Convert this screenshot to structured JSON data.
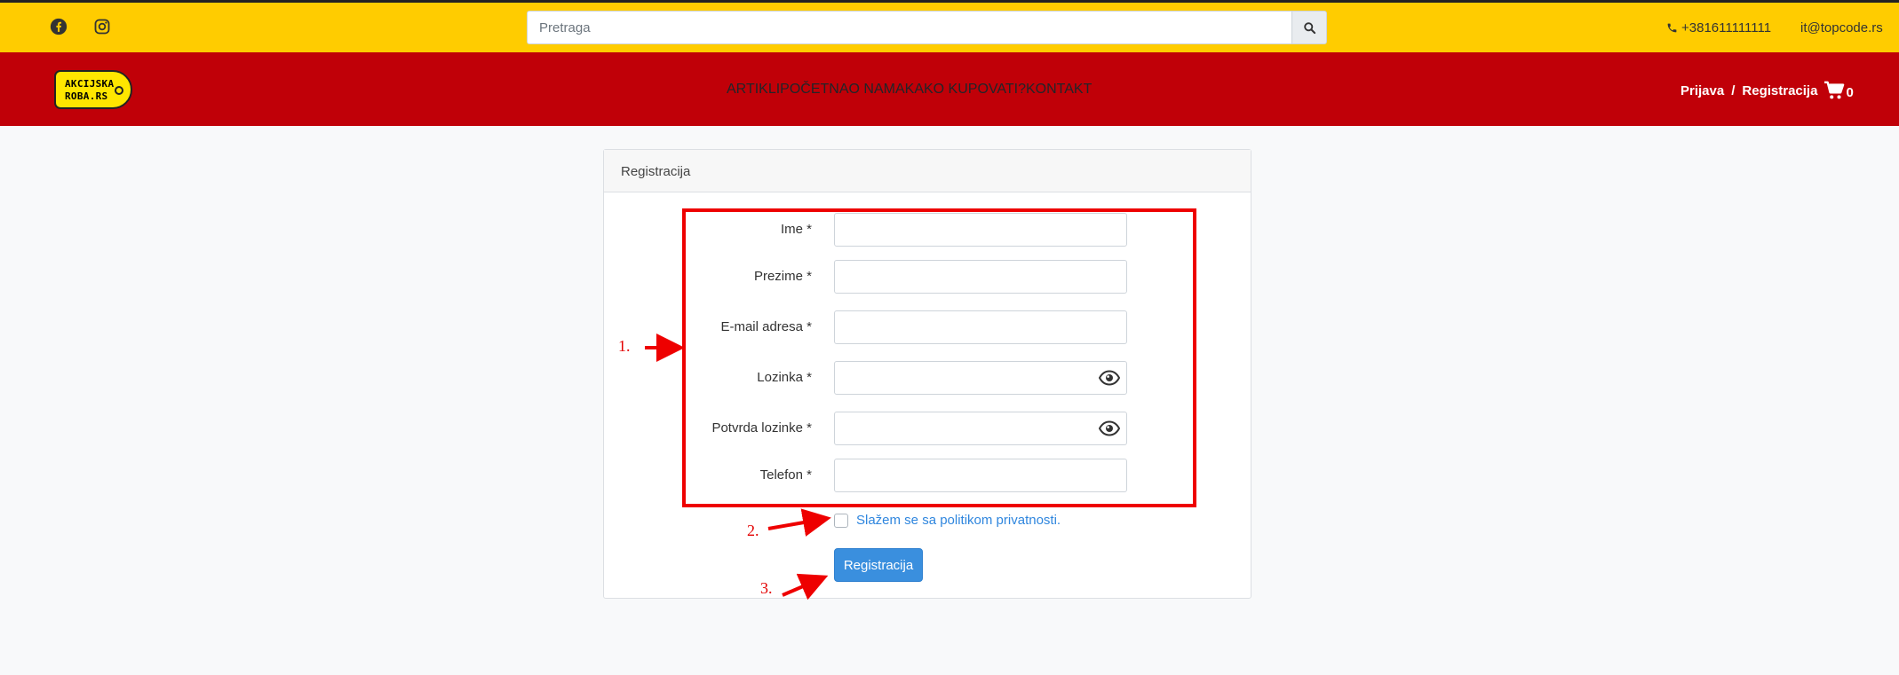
{
  "topbar": {
    "search_placeholder": "Pretraga",
    "phone": "+381611111111",
    "email": "it@topcode.rs",
    "icons": [
      "facebook-icon",
      "instagram-icon",
      "search-icon",
      "phone-icon"
    ]
  },
  "navbar": {
    "logo_line1": "AKCIJSKA",
    "logo_line2": "ROBA.RS",
    "menu": [
      "ARTIKLI",
      "POČETNA",
      "O NAMA",
      "KAKO KUPOVATI?",
      "KONTAKT"
    ],
    "login": "Prijava",
    "separator": "/",
    "register": "Registracija",
    "cart_count": "0"
  },
  "form": {
    "title": "Registracija",
    "fields": [
      {
        "label": "Ime *"
      },
      {
        "label": "Prezime *"
      },
      {
        "label": "E-mail adresa *"
      },
      {
        "label": "Lozinka *"
      },
      {
        "label": "Potvrda lozinke *"
      },
      {
        "label": "Telefon *"
      }
    ],
    "terms": "Slažem se sa politikom privatnosti.",
    "submit": "Registracija"
  },
  "annotations": [
    "1.",
    "2.",
    "3."
  ],
  "colors": {
    "topbar": "#ffcc00",
    "navbar": "#c00008",
    "link": "#2f86de",
    "button": "#3a8fde",
    "annotation": "#ee0000"
  }
}
